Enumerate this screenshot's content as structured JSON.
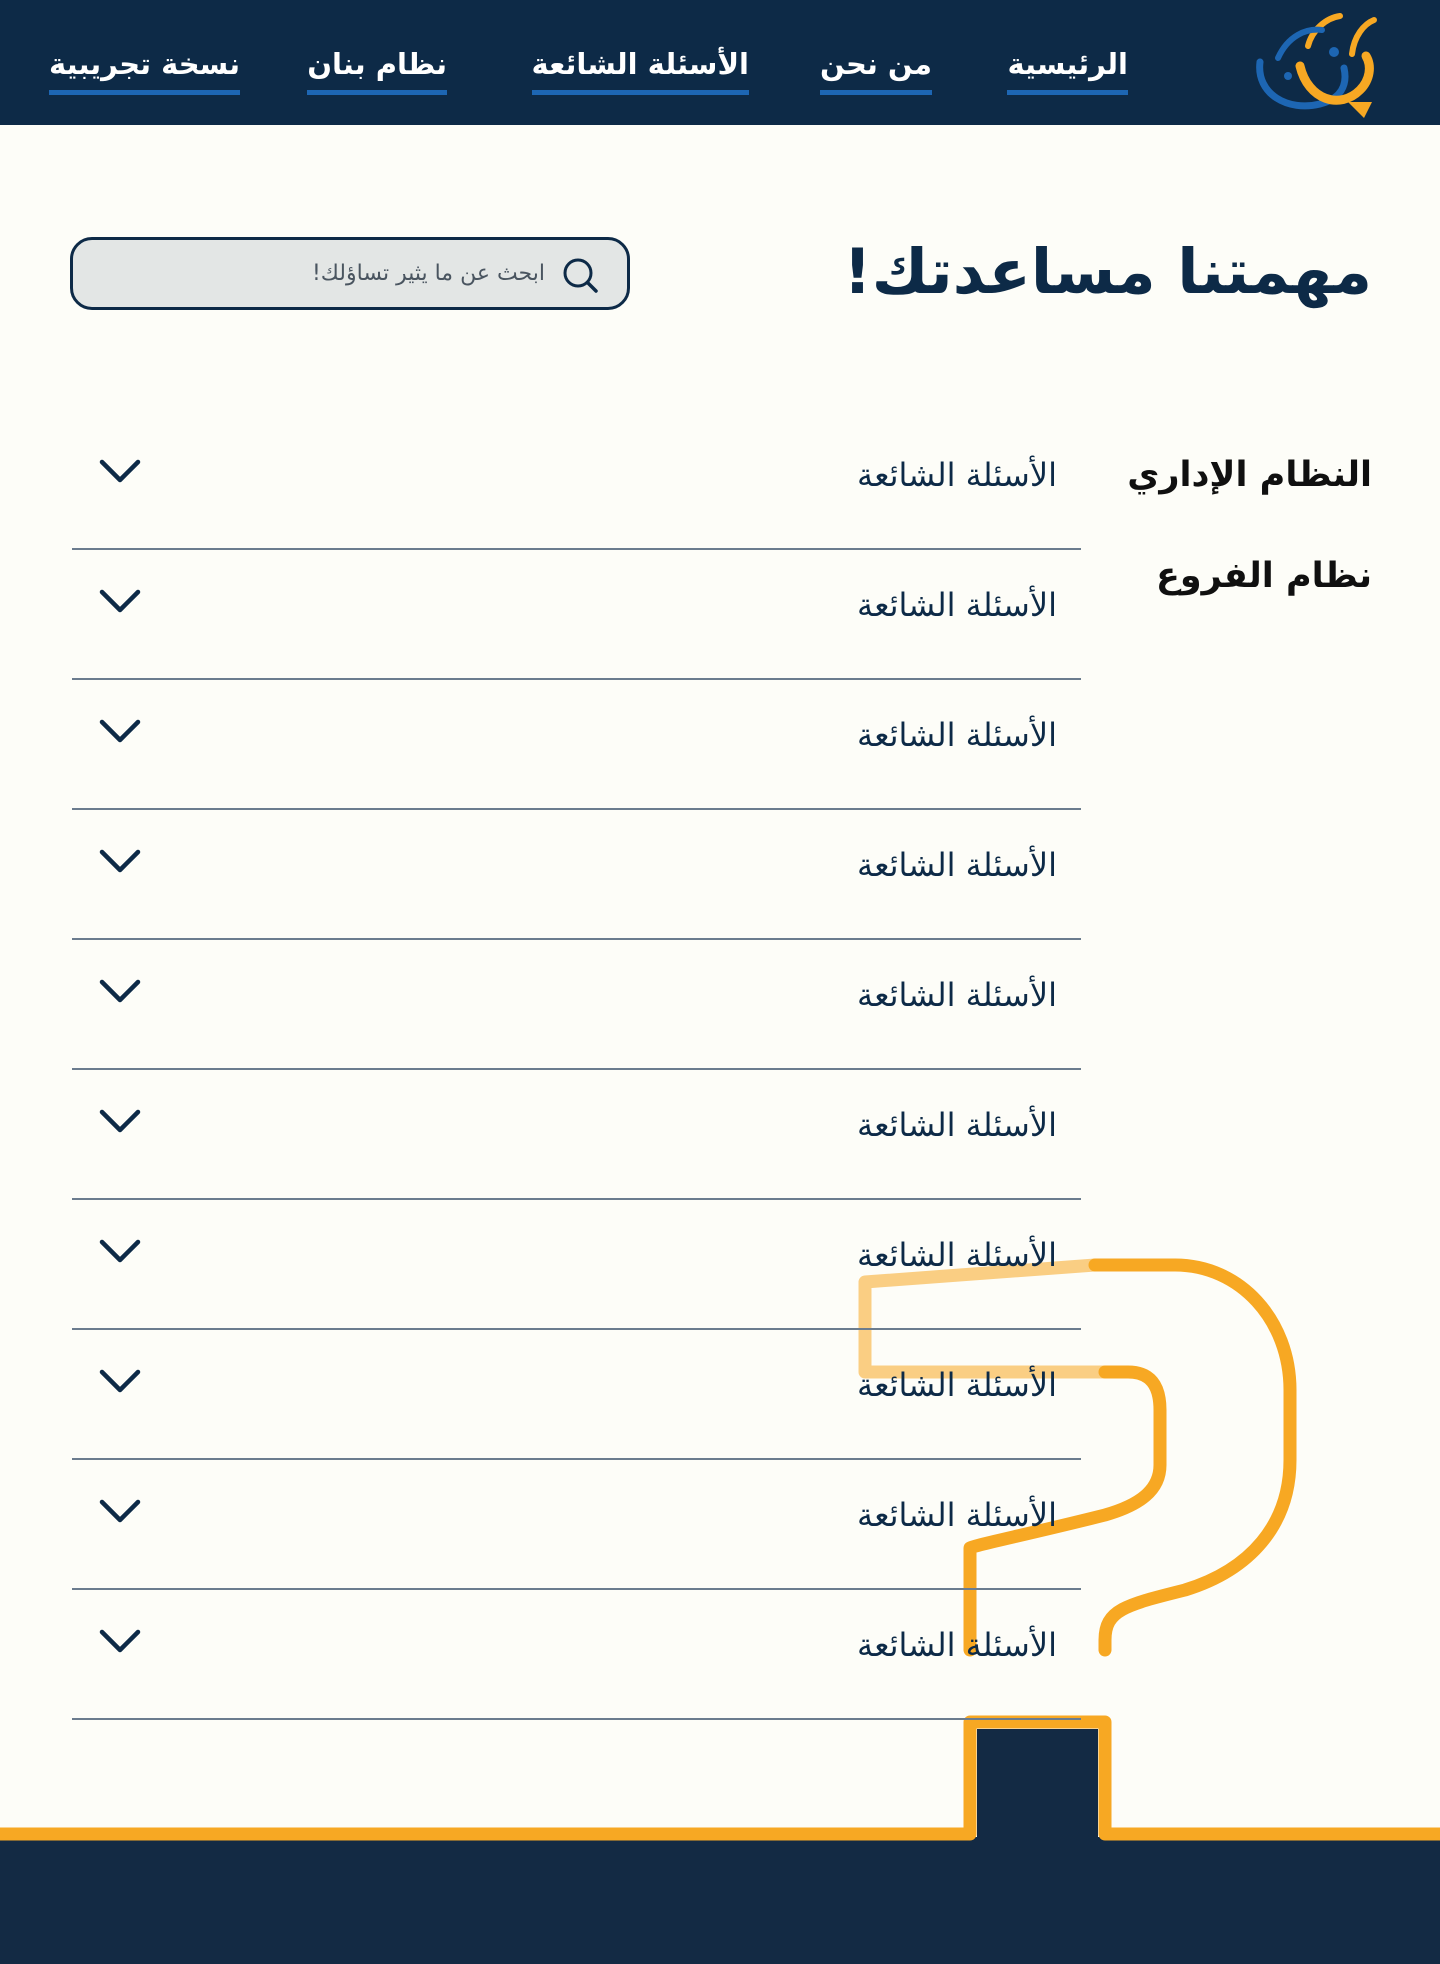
{
  "brand": {
    "logo_text": "بنان",
    "colors": {
      "primary": "#0d2a47",
      "accent": "#f7a823",
      "link": "#1d66b3",
      "background": "#fdfdf8"
    }
  },
  "nav": {
    "home": "الرئيسية",
    "about": "من نحن",
    "faq": "الأسئلة الشائعة",
    "system": "نظام بنان",
    "trial": "نسخة تجريبية"
  },
  "hero": {
    "title": "مهمتنا مساعدتك!",
    "search_placeholder": "ابحث عن ما يثير تساؤلك!",
    "search_icon": "search-icon"
  },
  "sidebar": {
    "items": [
      {
        "label": "النظام الإداري"
      },
      {
        "label": "نظام الفروع"
      }
    ]
  },
  "faq": {
    "chevron_icon": "chevron-down-icon",
    "items": [
      {
        "label": "الأسئلة الشائعة"
      },
      {
        "label": "الأسئلة الشائعة"
      },
      {
        "label": "الأسئلة الشائعة"
      },
      {
        "label": "الأسئلة الشائعة"
      },
      {
        "label": "الأسئلة الشائعة"
      },
      {
        "label": "الأسئلة الشائعة"
      },
      {
        "label": "الأسئلة الشائعة"
      },
      {
        "label": "الأسئلة الشائعة"
      },
      {
        "label": "الأسئلة الشائعة"
      },
      {
        "label": "الأسئلة الشائعة"
      }
    ]
  }
}
